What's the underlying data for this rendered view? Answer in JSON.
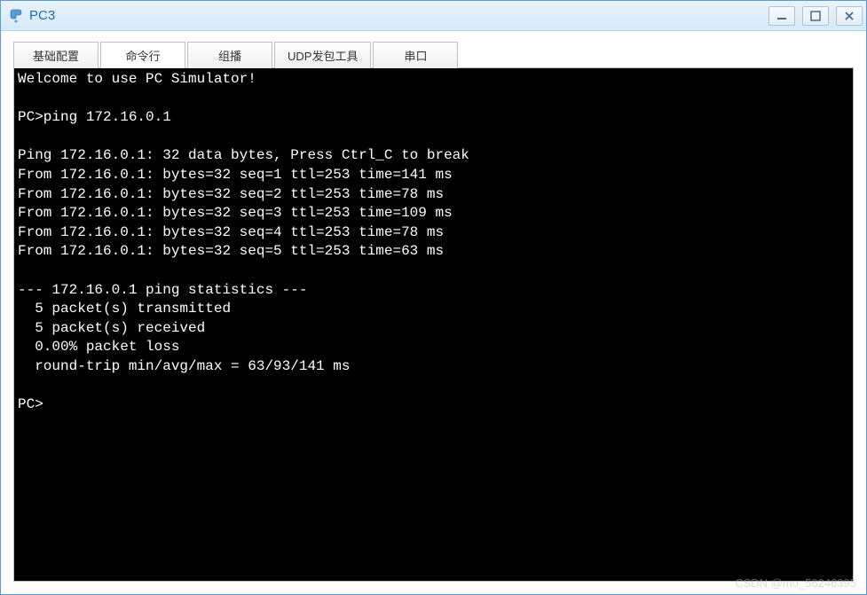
{
  "window": {
    "title": "PC3"
  },
  "tabs": [
    {
      "label": "基础配置",
      "active": false
    },
    {
      "label": "命令行",
      "active": true
    },
    {
      "label": "组播",
      "active": false
    },
    {
      "label": "UDP发包工具",
      "active": false
    },
    {
      "label": "串口",
      "active": false
    }
  ],
  "terminal": {
    "lines": [
      "Welcome to use PC Simulator!",
      "",
      "PC>ping 172.16.0.1",
      "",
      "Ping 172.16.0.1: 32 data bytes, Press Ctrl_C to break",
      "From 172.16.0.1: bytes=32 seq=1 ttl=253 time=141 ms",
      "From 172.16.0.1: bytes=32 seq=2 ttl=253 time=78 ms",
      "From 172.16.0.1: bytes=32 seq=3 ttl=253 time=109 ms",
      "From 172.16.0.1: bytes=32 seq=4 ttl=253 time=78 ms",
      "From 172.16.0.1: bytes=32 seq=5 ttl=253 time=63 ms",
      "",
      "--- 172.16.0.1 ping statistics ---",
      "  5 packet(s) transmitted",
      "  5 packet(s) received",
      "  0.00% packet loss",
      "  round-trip min/avg/max = 63/93/141 ms",
      "",
      "PC>"
    ]
  },
  "watermark": "CSDN @mo_56246395"
}
